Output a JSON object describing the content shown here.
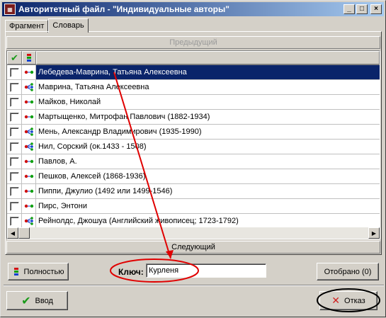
{
  "window": {
    "title": "Авторитетный файл - \"Индивидуальные авторы\"",
    "controls": [
      "_",
      "□",
      "×"
    ]
  },
  "tabs": [
    {
      "label": "Фрагмент"
    },
    {
      "label": "Словарь"
    }
  ],
  "nav": {
    "prev_label": "Предыдущий",
    "next_label": "Следующий"
  },
  "grid": {
    "header_check": "✔",
    "rows": [
      {
        "name": "Лебедева-Маврина, Татьяна Алексеевна",
        "icon": "link-dot-icon",
        "selected": true
      },
      {
        "name": "Маврина, Татьяна Алексеевна",
        "icon": "branch-icon"
      },
      {
        "name": "Майков, Николай",
        "icon": "link-dot-icon"
      },
      {
        "name": "Мартыщенко, Митрофан Павлович (1882-1934)",
        "icon": "link-dot-icon"
      },
      {
        "name": "Мень, Александр Владимирович (1935-1990)",
        "icon": "branch-icon"
      },
      {
        "name": "Нил, Сорский (ок.1433 - 1508)",
        "icon": "branch-icon"
      },
      {
        "name": "Павлов, А.",
        "icon": "link-dot-icon"
      },
      {
        "name": "Пешков, Алексей (1868-1936)",
        "icon": "link-dot-icon"
      },
      {
        "name": "Пиппи, Джулио (1492 или 1499-1546)",
        "icon": "link-dot-icon"
      },
      {
        "name": "Пирс, Энтони",
        "icon": "link-dot-icon"
      },
      {
        "name": "Рейнолдс, Джошуа (Английский живописец; 1723-1792)",
        "icon": "branch-icon"
      }
    ]
  },
  "footer": {
    "full_label": "Полностью",
    "key_label": "Ключ:",
    "key_value": "Курленя",
    "selected_label": "Отобрано (0)",
    "ok_label": "Ввод",
    "cancel_label": "Отказ"
  },
  "colors": {
    "title_bar": "#0a246a",
    "selection": "#0a246a",
    "annotation": "#e00000"
  }
}
